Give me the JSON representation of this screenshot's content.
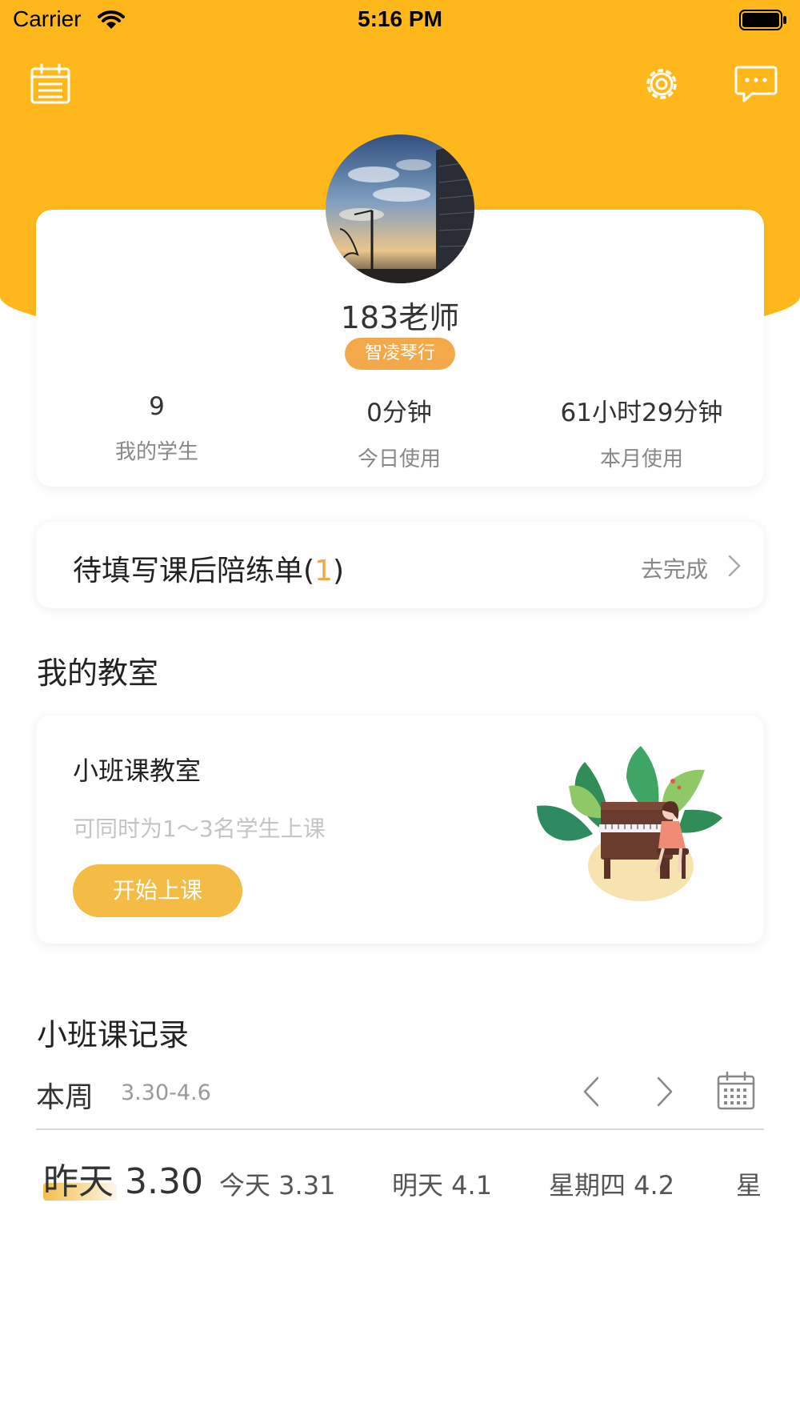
{
  "status_bar": {
    "carrier": "Carrier",
    "time": "5:16 PM"
  },
  "header": {
    "icons": [
      "calendar-icon",
      "gear-icon",
      "message-icon"
    ],
    "accent_color": "#FFB81C"
  },
  "profile": {
    "name": "183老师",
    "studio": "智凌琴行",
    "stats": [
      {
        "value": "9",
        "label": "我的学生"
      },
      {
        "value": "0分钟",
        "label": "今日使用"
      },
      {
        "value": "61小时29分钟",
        "label": "本月使用"
      }
    ]
  },
  "todo": {
    "title": "待填写课后陪练单(",
    "count": "1",
    "title_end": ")",
    "action": "去完成"
  },
  "classroom_section": {
    "title": "我的教室",
    "card": {
      "title": "小班课教室",
      "description": "可同时为1～3名学生上课",
      "button": "开始上课"
    }
  },
  "records_section": {
    "title": "小班课记录",
    "week_label": "本周",
    "week_range": "3.30-4.6",
    "days": [
      {
        "label": "昨天 3.30",
        "active": true
      },
      {
        "label": "今天 3.31",
        "active": false
      },
      {
        "label": "明天 4.1",
        "active": false
      },
      {
        "label": "星期四 4.2",
        "active": false
      },
      {
        "label": "星",
        "active": false
      }
    ]
  }
}
